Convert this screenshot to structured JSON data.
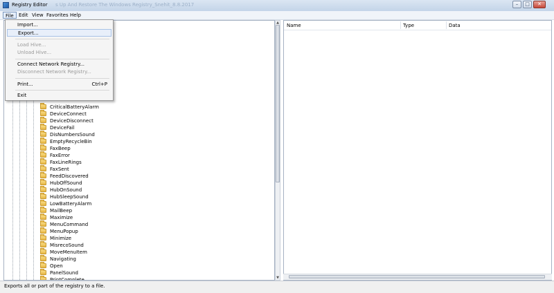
{
  "window": {
    "title": "Registry Editor",
    "ghost_title": "s Up And Restore The Windows Registry_Snehit_8.8.2017",
    "controls": {
      "minimize": "–",
      "maximize": "□",
      "close": "✕"
    }
  },
  "menubar": [
    "File",
    "Edit",
    "View",
    "Favorites",
    "Help"
  ],
  "file_menu": {
    "import": "Import...",
    "export": "Export...",
    "load_hive": "Load Hive...",
    "unload_hive": "Unload Hive...",
    "connect": "Connect Network Registry...",
    "disconnect": "Disconnect Network Registry...",
    "print": "Print...",
    "print_shortcut": "Ctrl+P",
    "exit": "Exit"
  },
  "tree_items": [
    "CriticalBatteryAlarm",
    "DeviceConnect",
    "DeviceDisconnect",
    "DeviceFail",
    "DisNumbersSound",
    "EmptyRecycleBin",
    "FaxBeep",
    "FaxError",
    "FaxLineRings",
    "FaxSent",
    "FeedDiscovered",
    "HubOffSound",
    "HubOnSound",
    "HubSleepSound",
    "LowBatteryAlarm",
    "MailBeep",
    "Maximize",
    "MenuCommand",
    "MenuPopup",
    "Minimize",
    "MisrecoSound",
    "MoveMenuItem",
    "Navigating",
    "Open",
    "PanelSound",
    "PrintComplete"
  ],
  "columns": {
    "name": "Name",
    "type": "Type",
    "data": "Data"
  },
  "status": "Exports all or part of the registry to a file."
}
